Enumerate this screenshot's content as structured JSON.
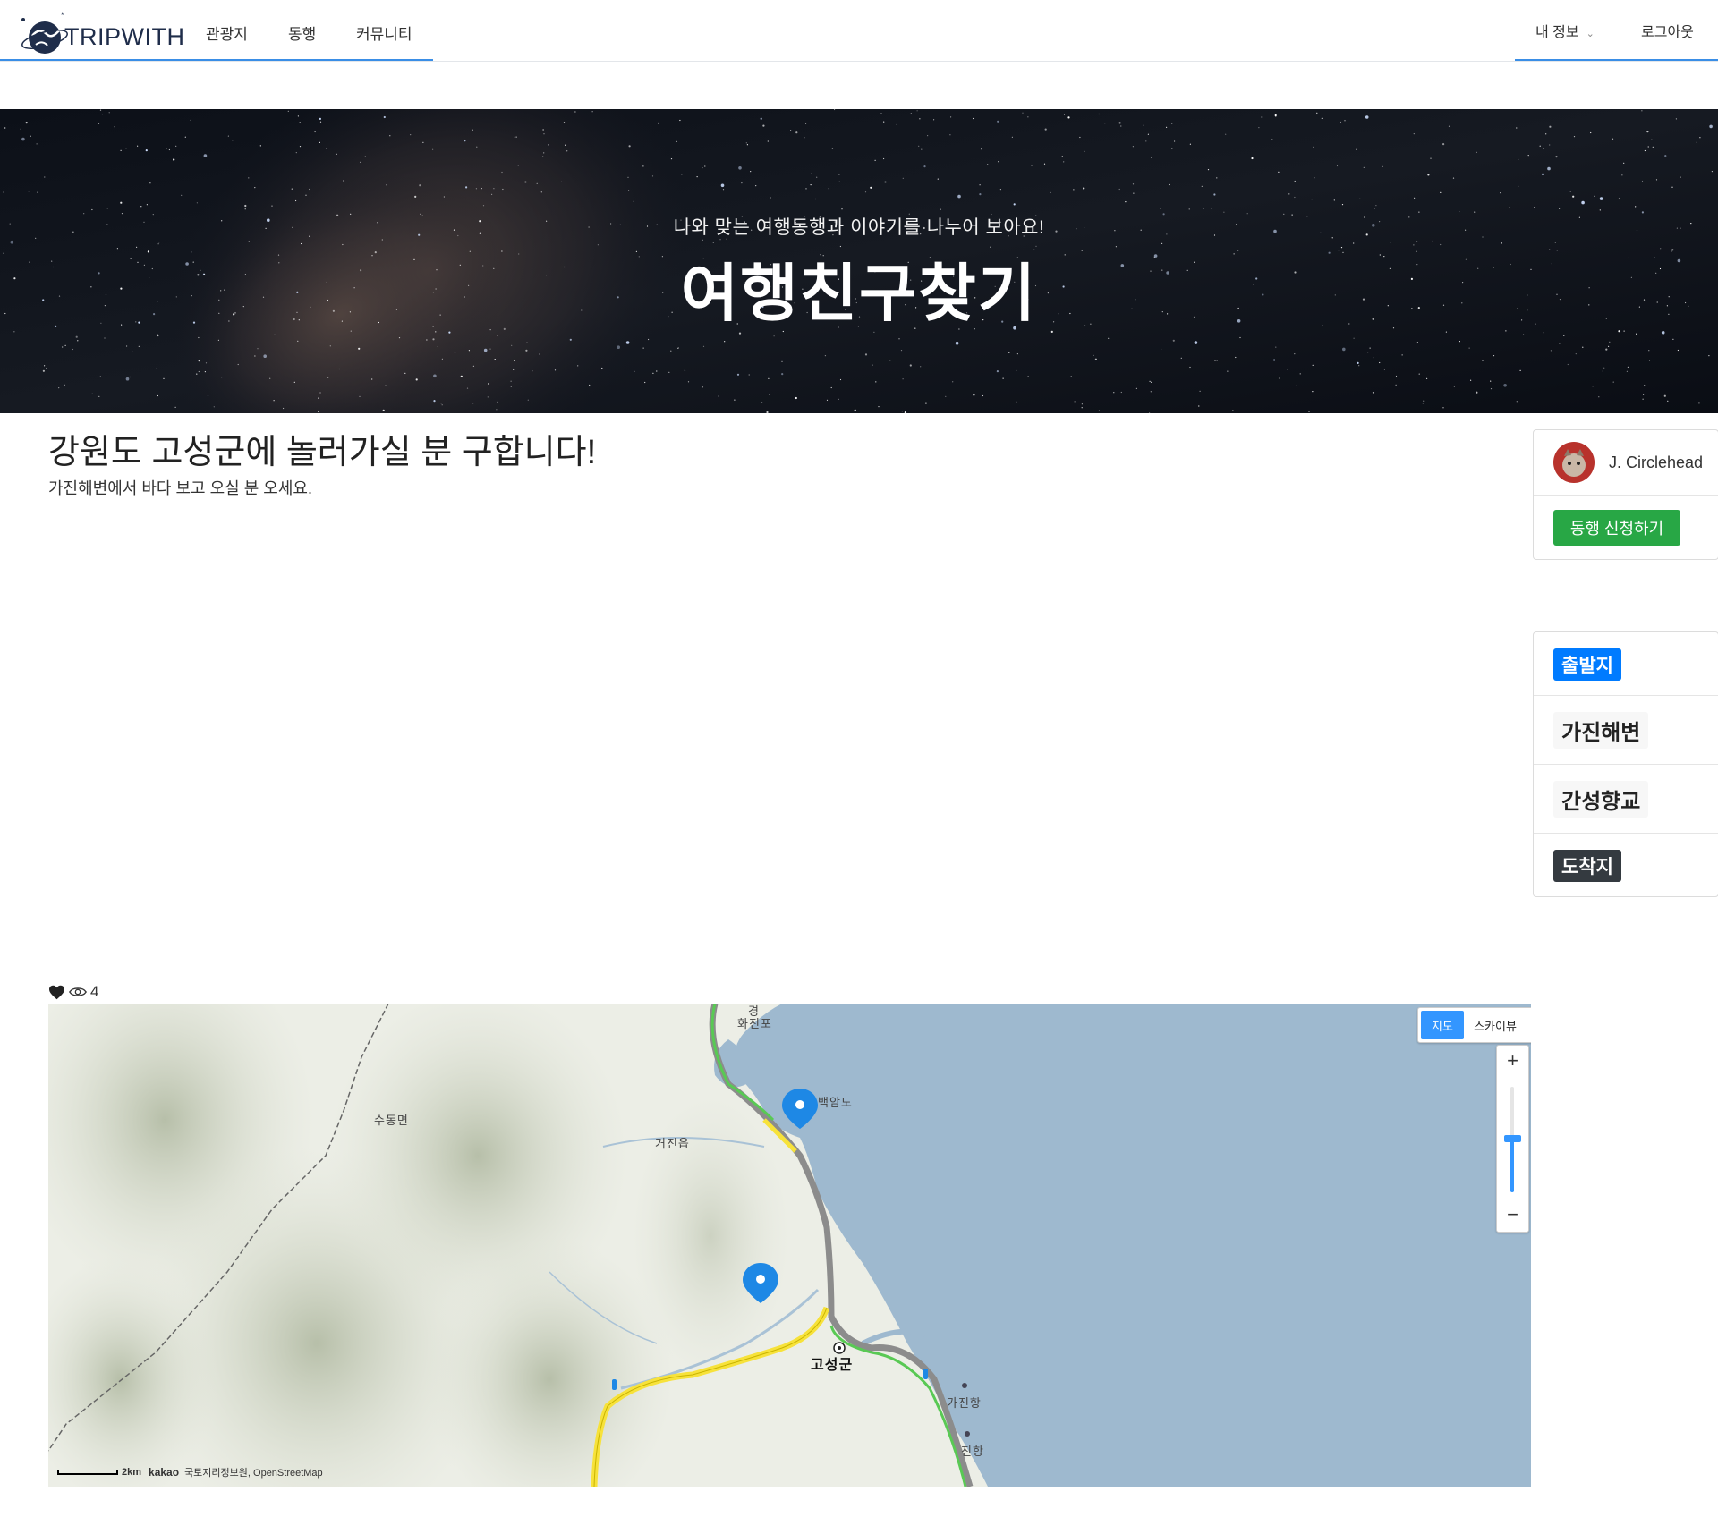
{
  "nav": {
    "logo_text": "TRIPWITH",
    "links": [
      "관광지",
      "동행",
      "커뮤니티"
    ],
    "my_info": "내 정보",
    "logout": "로그아웃"
  },
  "hero": {
    "subtitle": "나와 맞는 여행동행과 이야기를 나누어 보아요!",
    "title": "여행친구찾기"
  },
  "post": {
    "title": "강원도 고성군에 놀러가실 분 구합니다!",
    "description": "가진해변에서 바다 보고 오실 분 오세요."
  },
  "author": {
    "name": "J. Circlehead",
    "apply_label": "동행 신청하기"
  },
  "route": {
    "start_label": "출발지",
    "stops": [
      "가진해변",
      "간성향교"
    ],
    "end_label": "도착지"
  },
  "stats": {
    "views": "4"
  },
  "map": {
    "toggle_map": "지도",
    "toggle_sky": "스카이뷰",
    "labels": {
      "sudong": "수동면",
      "geojin": "거진읍",
      "baegamdo": "백암도",
      "goseong": "고성군",
      "gajinhang": "가진항",
      "hwajinpo": "화진포",
      "gyeong": "경",
      "bottom_hang": "진항"
    },
    "scale": "2km",
    "brand": "kakao",
    "attribution": "국토지리정보원, OpenStreetMap"
  },
  "colors": {
    "accent": "#3a8ee6",
    "apply_green": "#28a745",
    "start_blue": "#007bff",
    "end_dark": "#343a40",
    "sea": "#9eb9cf",
    "marker_blue": "#1e88e5"
  }
}
